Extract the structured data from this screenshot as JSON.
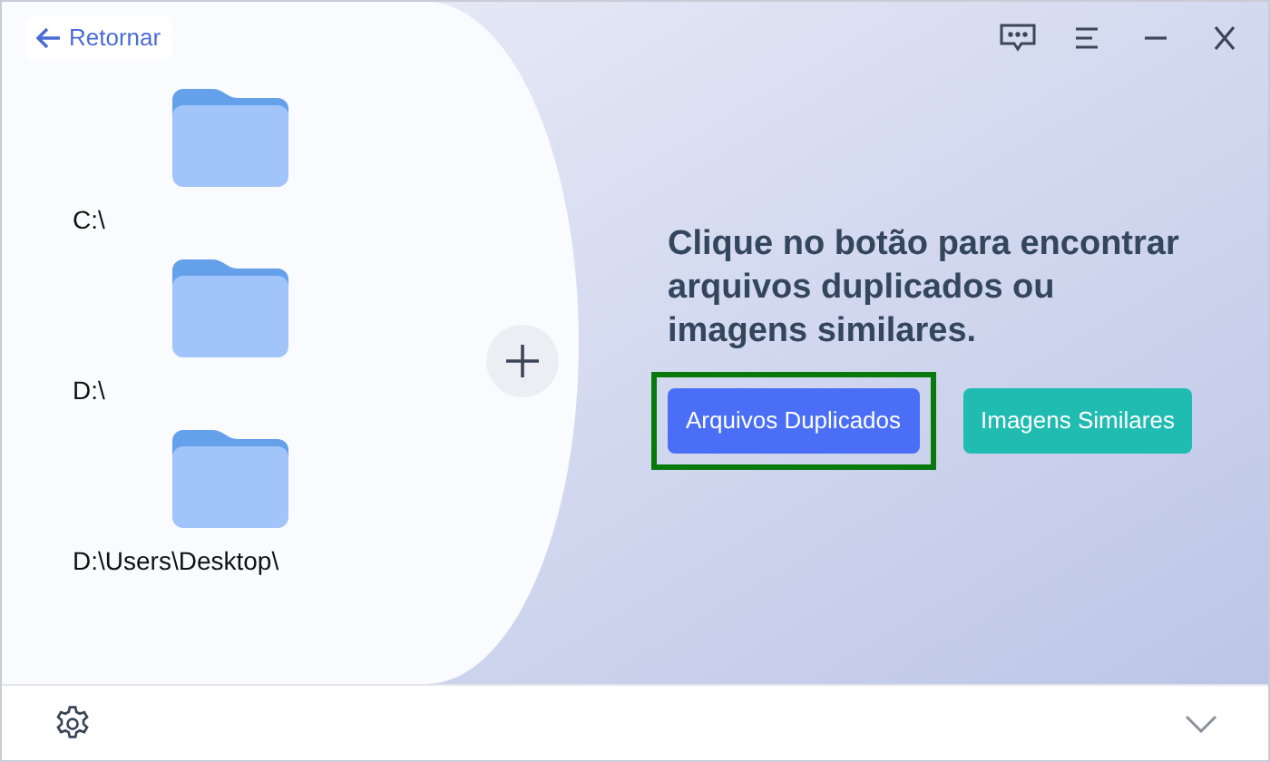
{
  "back_link": {
    "label": "Retornar"
  },
  "folders": [
    {
      "path": "C:\\"
    },
    {
      "path": "D:\\"
    },
    {
      "path": "D:\\Users\\Desktop\\"
    }
  ],
  "prompt": "Clique no botão para encontrar arquivos duplicados ou imagens similares.",
  "buttons": [
    {
      "label": "Arquivos Duplicados",
      "kind": "primary",
      "highlighted": true
    },
    {
      "label": "Imagens Similares",
      "kind": "secondary",
      "highlighted": false
    }
  ]
}
